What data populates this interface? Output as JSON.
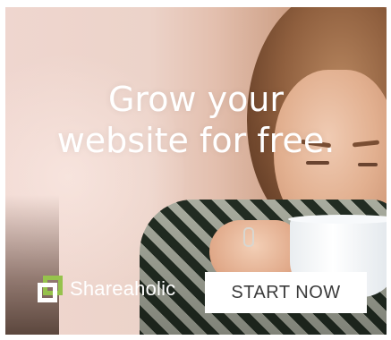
{
  "ad": {
    "headline_line1": "Grow your",
    "headline_line2": "website for free.",
    "brand": "Shareaholic",
    "cta_label": "START NOW",
    "colors": {
      "brand_green": "#96c24c",
      "cta_bg": "#ffffff",
      "cta_text": "#3b3b3b",
      "headline": "#ffffff"
    },
    "icons": [
      "shareaholic-logo-icon"
    ]
  }
}
